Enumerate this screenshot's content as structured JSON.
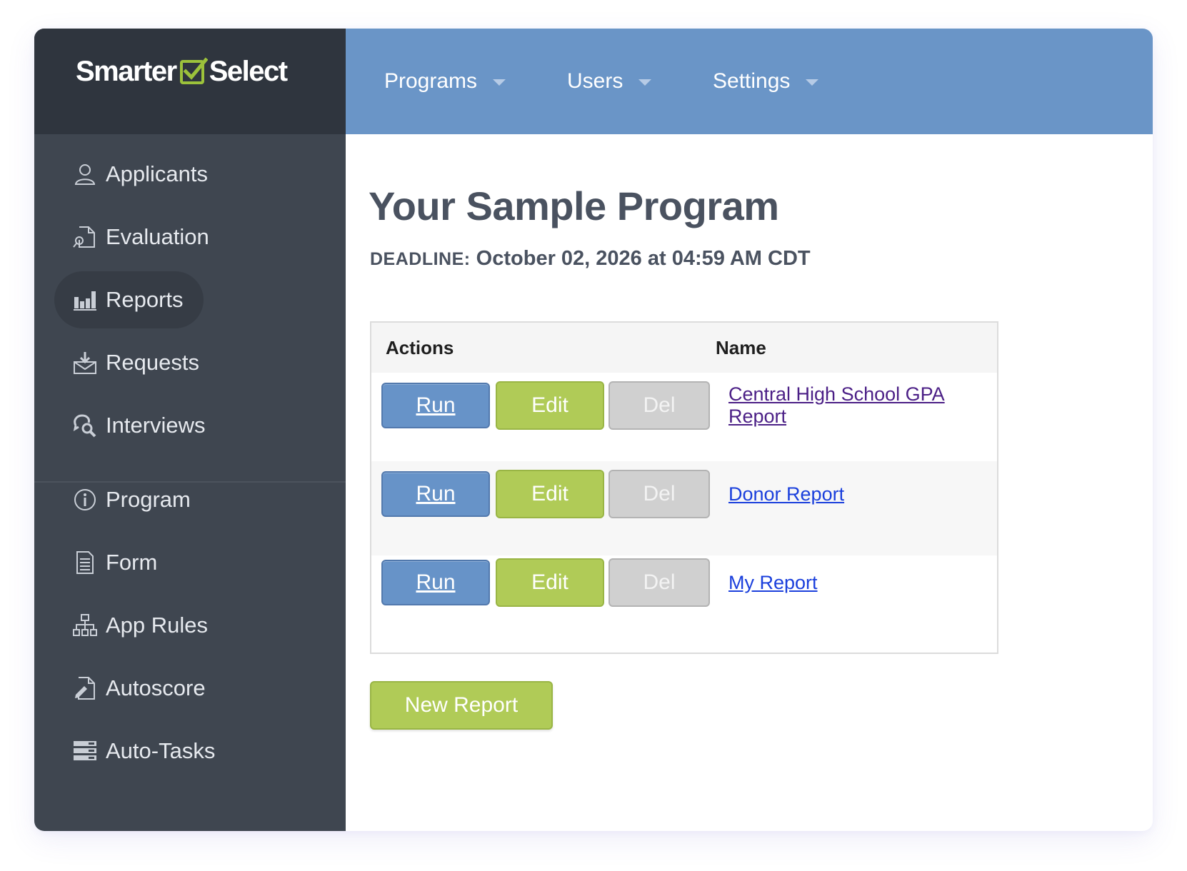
{
  "brand": {
    "name_left": "Smarter",
    "name_right": "Select",
    "accent_color": "#9cc23b"
  },
  "topnav": [
    {
      "label": "Programs"
    },
    {
      "label": "Users"
    },
    {
      "label": "Settings"
    }
  ],
  "sidebar": {
    "items": [
      {
        "label": "Applicants",
        "icon": "user-icon"
      },
      {
        "label": "Evaluation",
        "icon": "document-search-icon"
      },
      {
        "label": "Reports",
        "icon": "bar-chart-icon",
        "active": true
      },
      {
        "label": "Requests",
        "icon": "inbox-download-icon"
      },
      {
        "label": "Interviews",
        "icon": "chat-search-icon"
      },
      {
        "label": "Program",
        "icon": "info-icon"
      },
      {
        "label": "Form",
        "icon": "form-icon"
      },
      {
        "label": "App Rules",
        "icon": "hierarchy-icon"
      },
      {
        "label": "Autoscore",
        "icon": "document-pen-icon"
      },
      {
        "label": "Auto-Tasks",
        "icon": "tasks-icon"
      }
    ]
  },
  "main": {
    "title": "Your Sample Program",
    "deadline_label": "DEADLINE:",
    "deadline_value": "October 02, 2026 at 04:59 AM CDT",
    "table": {
      "headers": [
        "Actions",
        "Name"
      ],
      "rows": [
        {
          "run": "Run",
          "edit": "Edit",
          "del": "Del",
          "name": "Central High School GPA Report"
        },
        {
          "run": "Run",
          "edit": "Edit",
          "del": "Del",
          "name": "Donor Report"
        },
        {
          "run": "Run",
          "edit": "Edit",
          "del": "Del",
          "name": "My Report"
        }
      ]
    },
    "new_report_label": "New Report"
  }
}
